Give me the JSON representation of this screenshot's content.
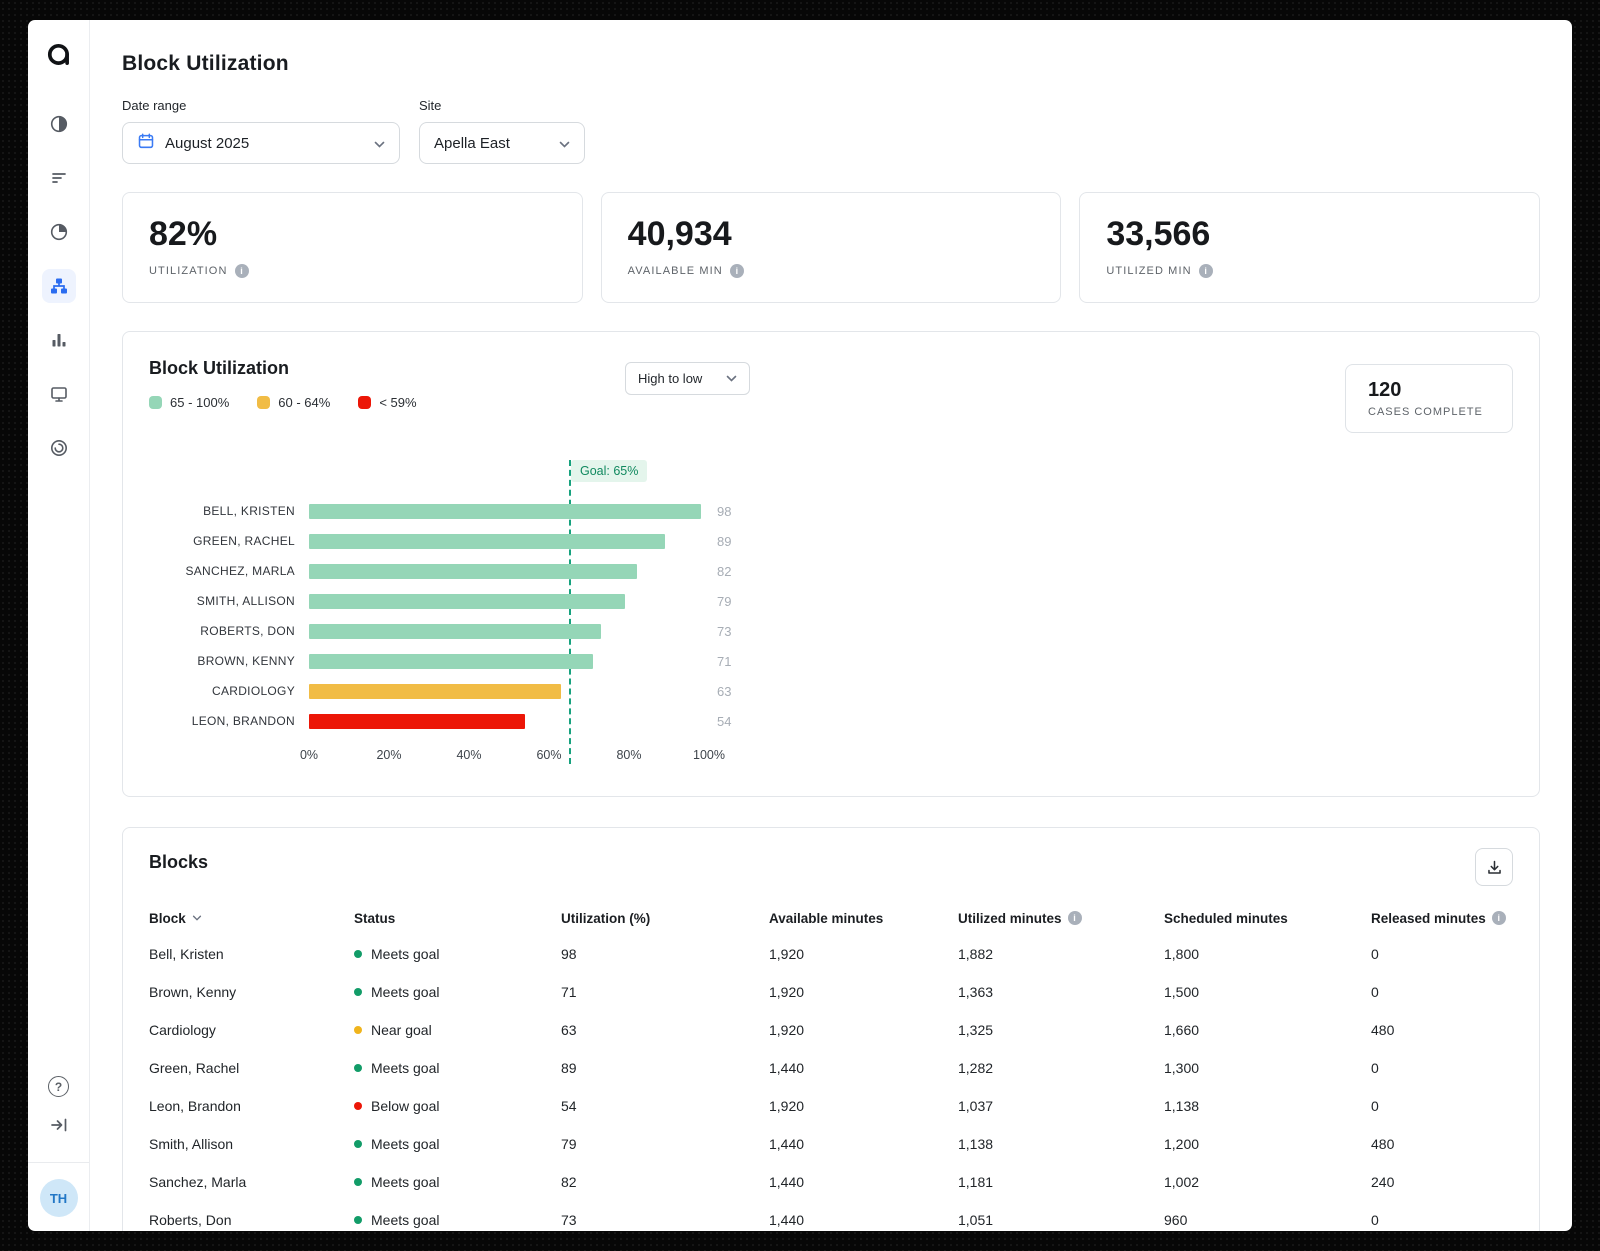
{
  "header": {
    "title": "Block Utilization"
  },
  "sidebar": {
    "avatar_initials": "TH",
    "help_glyph": "?"
  },
  "filters": {
    "date_range": {
      "label": "Date range",
      "value": "August 2025"
    },
    "site": {
      "label": "Site",
      "value": "Apella East"
    }
  },
  "kpis": [
    {
      "value": "82%",
      "label": "UTILIZATION"
    },
    {
      "value": "40,934",
      "label": "AVAILABLE MIN"
    },
    {
      "value": "33,566",
      "label": "UTILIZED MIN"
    }
  ],
  "utilization_card": {
    "title": "Block Utilization",
    "sort": "High to low",
    "cases_value": "120",
    "cases_label": "CASES COMPLETE",
    "goal_label": "Goal: 65%",
    "legend": [
      {
        "label": "65 - 100%",
        "color": "#95d6b7"
      },
      {
        "label": "60 - 64%",
        "color": "#f1bc45"
      },
      {
        "label": "< 59%",
        "color": "#ec1607"
      }
    ]
  },
  "chart_data": {
    "type": "bar",
    "orientation": "horizontal",
    "title": "Block Utilization",
    "categories": [
      "BELL, KRISTEN",
      "GREEN, RACHEL",
      "SANCHEZ, MARLA",
      "SMITH, ALLISON",
      "ROBERTS, DON",
      "BROWN, KENNY",
      "CARDIOLOGY",
      "LEON, BRANDON"
    ],
    "values": [
      98,
      89,
      82,
      79,
      73,
      71,
      63,
      54
    ],
    "bar_colors": [
      "#95d6b7",
      "#95d6b7",
      "#95d6b7",
      "#95d6b7",
      "#95d6b7",
      "#95d6b7",
      "#f1bc45",
      "#ec1607"
    ],
    "goal": 65,
    "xlim": [
      0,
      100
    ],
    "x_ticks": [
      "0%",
      "20%",
      "40%",
      "60%",
      "80%",
      "100%"
    ],
    "legend_position": "top-left",
    "value_label_color": "#a7adb5"
  },
  "blocks_card": {
    "title": "Blocks",
    "columns": [
      {
        "label": "Block",
        "sort": true,
        "info": false
      },
      {
        "label": "Status",
        "sort": false,
        "info": false
      },
      {
        "label": "Utilization (%)",
        "sort": false,
        "info": false
      },
      {
        "label": "Available minutes",
        "sort": false,
        "info": false
      },
      {
        "label": "Utilized minutes",
        "sort": false,
        "info": true
      },
      {
        "label": "Scheduled minutes",
        "sort": false,
        "info": false
      },
      {
        "label": "Released minutes",
        "sort": false,
        "info": true
      }
    ],
    "rows": [
      [
        "Bell, Kristen",
        "Meets goal",
        "98",
        "1,920",
        "1,882",
        "1,800",
        "0"
      ],
      [
        "Brown, Kenny",
        "Meets goal",
        "71",
        "1,920",
        "1,363",
        "1,500",
        "0"
      ],
      [
        "Cardiology",
        "Near goal",
        "63",
        "1,920",
        "1,325",
        "1,660",
        "480"
      ],
      [
        "Green, Rachel",
        "Meets goal",
        "89",
        "1,440",
        "1,282",
        "1,300",
        "0"
      ],
      [
        "Leon, Brandon",
        "Below goal",
        "54",
        "1,920",
        "1,037",
        "1,138",
        "0"
      ],
      [
        "Smith, Allison",
        "Meets goal",
        "79",
        "1,440",
        "1,138",
        "1,200",
        "480"
      ],
      [
        "Sanchez, Marla",
        "Meets goal",
        "82",
        "1,440",
        "1,181",
        "1,002",
        "240"
      ],
      [
        "Roberts, Don",
        "Meets goal",
        "73",
        "1,440",
        "1,051",
        "960",
        "0"
      ]
    ],
    "status_colors": {
      "Meets goal": "#129c68",
      "Near goal": "#f0b41c",
      "Below goal": "#ec1607"
    }
  },
  "colors": {
    "goal_line": "#17a27e",
    "active_nav": "#2b6cf0",
    "calendar_icon": "#3b7bf4"
  }
}
